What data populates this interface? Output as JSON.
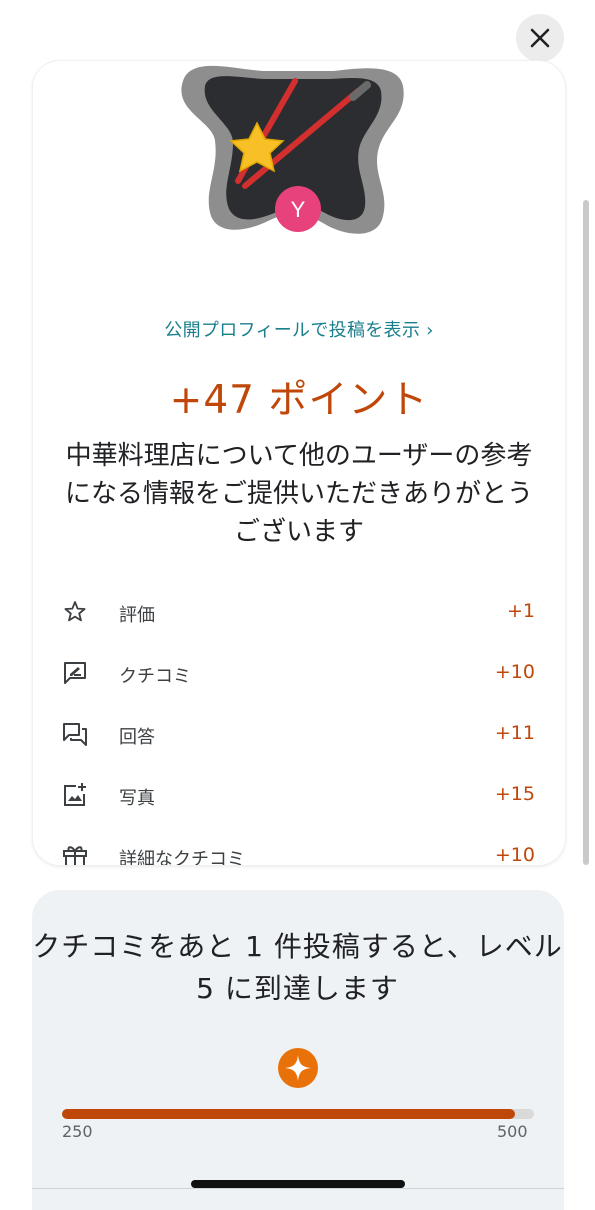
{
  "header": {
    "close_icon": "close-icon"
  },
  "hero": {
    "icon": "star-chopsticks-illustration",
    "avatar_letter": "Y",
    "avatar_color": "#e8427c"
  },
  "profile_link": "公開プロフィールで投稿を表示 ›",
  "points": "+47 ポイント",
  "thanks": "中華料理店について他のユーザーの参考になる情報をご提供いただきありがとうございます",
  "rows": [
    {
      "icon": "star-outline-icon",
      "label": "評価",
      "value": "+1"
    },
    {
      "icon": "review-edit-icon",
      "label": "クチコミ",
      "value": "+10"
    },
    {
      "icon": "answers-icon",
      "label": "回答",
      "value": "+11"
    },
    {
      "icon": "add-photo-icon",
      "label": "写真",
      "value": "+15"
    },
    {
      "icon": "gift-icon",
      "label": "詳細なクチコミ",
      "value": "+10"
    }
  ],
  "level": {
    "message": "クチコミをあと 1 件投稿すると、レベル 5 に到達します",
    "badge_icon": "sparkle-badge-icon",
    "progress_min": "250",
    "progress_max": "500",
    "progress_fraction": 0.96
  },
  "colors": {
    "accent": "#c0470a",
    "link": "#1a7f8c"
  }
}
